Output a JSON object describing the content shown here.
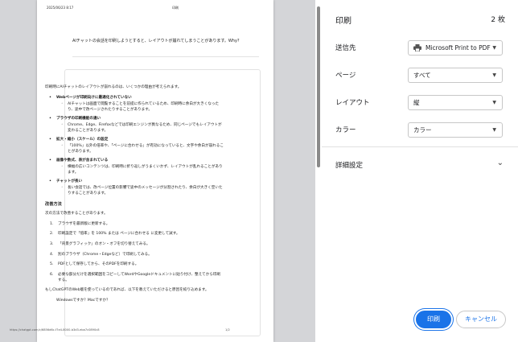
{
  "page": {
    "header_date": "2025/06/23 8:17",
    "header_title": "印刷",
    "question": "AIチャットの会話を印刷しようとすると、レイアウトが崩れてしまうことがあります。Why?",
    "intro": "印刷時にAIチャットのレイアウトが崩れるのは、いくつかの理由が考えられます。",
    "sections": [
      {
        "title": "Webページが印刷向けに最適化されていない",
        "detail": "AIチャットは画面で閲覧することを前提に作られているため、印刷時に余白が大きくなったり、途中で改ページされたりすることがあります。"
      },
      {
        "title": "ブラウザの印刷機能の違い",
        "detail": "Chrome、Edge、Firefoxなどでは印刷エンジンが異なるため、同じページでもレイアウトが変わることがあります。"
      },
      {
        "title": "拡大・縮小（スケール）の設定",
        "detail": "「100%」以外の倍率や、「ページに合わせる」が有効になっていると、文字や余白が崩れることがあります。"
      },
      {
        "title": "画像や数式、表が含まれている",
        "detail": "横幅の広いコンテンツは、印刷時に折り返しがうまくいかず、レイアウトが乱れることがあります。"
      },
      {
        "title": "チャットが長い",
        "detail": "長い会話では、改ページ位置の影響で途中のメッセージが分割されたり、余白が大きく空いたりすることがあります。"
      }
    ],
    "fix_heading": "改善方法",
    "fix_intro": "次の方法で改善することがあります。",
    "fix_steps": [
      "ブラウザを最新版に更新する。",
      "印刷設定で「倍率」を 100% または ページに合わせる に変更して試す。",
      "「背景グラフィック」のオン・オフを切り替えてみる。",
      "別のブラウザ（Chrome・Edgeなど）で印刷してみる。",
      "PDFとして保存してから、そのPDFを印刷する。",
      "必要な部分だけを選択範囲をコピーしてWordやGoogleドキュメントに貼り付け、整えてから印刷する。"
    ],
    "note": "もしChatGPTのWeb版を使っているのであれば、以下を教えていただけると原因を絞り込めます。",
    "bullet_last": "Windowsですか？Macですか？",
    "footer_url": "https://chatgpt.com/c/6856d6c-f7e4-8000-b3d3-eba7c0890c8",
    "footer_page": "1/2"
  },
  "panel": {
    "title": "印刷",
    "sheet_count": "2 枚",
    "destination_label": "送信先",
    "destination_value": "Microsoft Print to PDF",
    "pages_label": "ページ",
    "pages_value": "すべて",
    "layout_label": "レイアウト",
    "layout_value": "縦",
    "color_label": "カラー",
    "color_value": "カラー",
    "more_settings_label": "詳細設定",
    "print_button": "印刷",
    "cancel_button": "キャンセル"
  },
  "icons": {
    "printer": "printer-icon",
    "dropdown": "chevron-down-icon"
  },
  "colors": {
    "accent": "#1a73e8",
    "preview_bg": "#d4d5d8"
  }
}
